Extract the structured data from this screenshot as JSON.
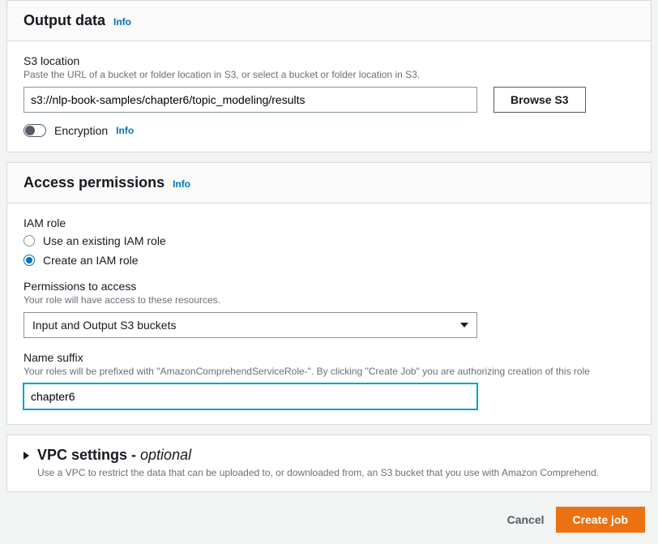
{
  "outputData": {
    "title": "Output data",
    "info": "Info",
    "s3location": {
      "label": "S3 location",
      "hint": "Paste the URL of a bucket or folder location in S3, or select a bucket or folder location in S3.",
      "value": "s3://nlp-book-samples/chapter6/topic_modeling/results",
      "browseLabel": "Browse S3"
    },
    "encryption": {
      "label": "Encryption",
      "info": "Info"
    }
  },
  "accessPermissions": {
    "title": "Access permissions",
    "info": "Info",
    "iamRole": {
      "label": "IAM role",
      "options": {
        "existing": "Use an existing IAM role",
        "create": "Create an IAM role"
      }
    },
    "permissions": {
      "label": "Permissions to access",
      "hint": "Your role will have access to these resources.",
      "selected": "Input and Output S3 buckets"
    },
    "nameSuffix": {
      "label": "Name suffix",
      "hint": "Your roles will be prefixed with \"AmazonComprehendServiceRole-\". By clicking \"Create Job\" you are authorizing creation of this role",
      "value": "chapter6"
    }
  },
  "vpc": {
    "title": "VPC settings - ",
    "optional": "optional",
    "description": "Use a VPC to restrict the data that can be uploaded to, or downloaded from, an S3 bucket that you use with Amazon Comprehend."
  },
  "footer": {
    "cancel": "Cancel",
    "createJob": "Create job"
  }
}
